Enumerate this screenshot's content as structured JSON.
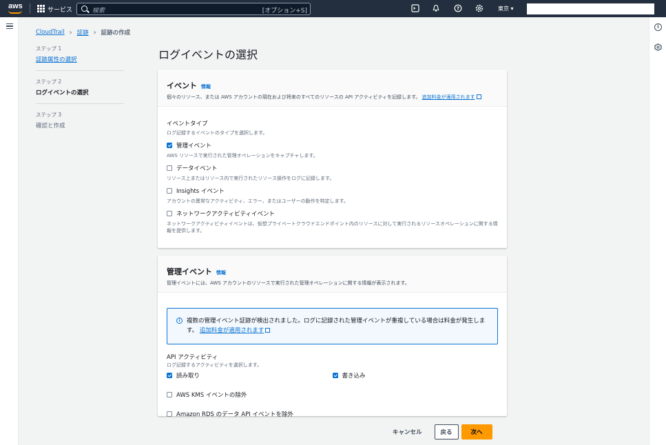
{
  "topbar": {
    "logo": "aws",
    "services": "サービス",
    "search_placeholder": "検索",
    "search_shortcut": "[オプション+S]",
    "region": "東京 ▾"
  },
  "breadcrumb": {
    "item1": "CloudTrail",
    "item2": "証跡",
    "current": "証跡の作成"
  },
  "steps": [
    {
      "num": "ステップ 1",
      "label": "証跡属性の選択"
    },
    {
      "num": "ステップ 2",
      "label": "ログイベントの選択"
    },
    {
      "num": "ステップ 3",
      "label": "確認と作成"
    }
  ],
  "page_title": "ログイベントの選択",
  "events_card": {
    "title": "イベント",
    "info": "情報",
    "desc": "個々のリソース、または AWS アカウントの現在および将来のすべてのリソースの API アクティビティを記録します。",
    "desc_link": "追加料金が適用されます",
    "event_type_label": "イベントタイプ",
    "event_type_desc": "ログ記録するイベントのタイプを選択します。",
    "options": [
      {
        "label": "管理イベント",
        "desc": "AWS リソースで実行された管理オペレーションをキャプチャします。",
        "checked": true
      },
      {
        "label": "データイベント",
        "desc": "リソース上またはリソース内で実行されたリソース操作をログに記録します。",
        "checked": false
      },
      {
        "label": "Insights イベント",
        "desc": "アカウントの異常なアクティビティ、エラー、またはユーザーの動作を特定します。",
        "checked": false
      },
      {
        "label": "ネットワークアクティビティイベント",
        "desc": "ネットワークアクティビティイベントは、仮想プライベートクラウドエンドポイント内のリソースに対して実行されるリソースオペレーションに関する情報を提供します。",
        "checked": false
      }
    ]
  },
  "mgmt_card": {
    "title": "管理イベント",
    "info": "情報",
    "desc": "管理イベントには、AWS アカウントのリソースで実行された管理オペレーションに関する情報が表示されます。",
    "alert_text": "複数の管理イベント証跡が検出されました。ログに記録された管理イベントが重複している場合は料金が発生します。",
    "alert_link": "追加料金が適用されます",
    "api_label": "API アクティビティ",
    "api_desc": "ログ記録するアクティビティを選択します。",
    "read": "読み取り",
    "write": "書き込み",
    "kms": "AWS KMS イベントの除外",
    "rds": "Amazon RDS のデータ API イベントを除外"
  },
  "footer": {
    "cancel": "キャンセル",
    "back": "戻る",
    "next": "次へ"
  }
}
